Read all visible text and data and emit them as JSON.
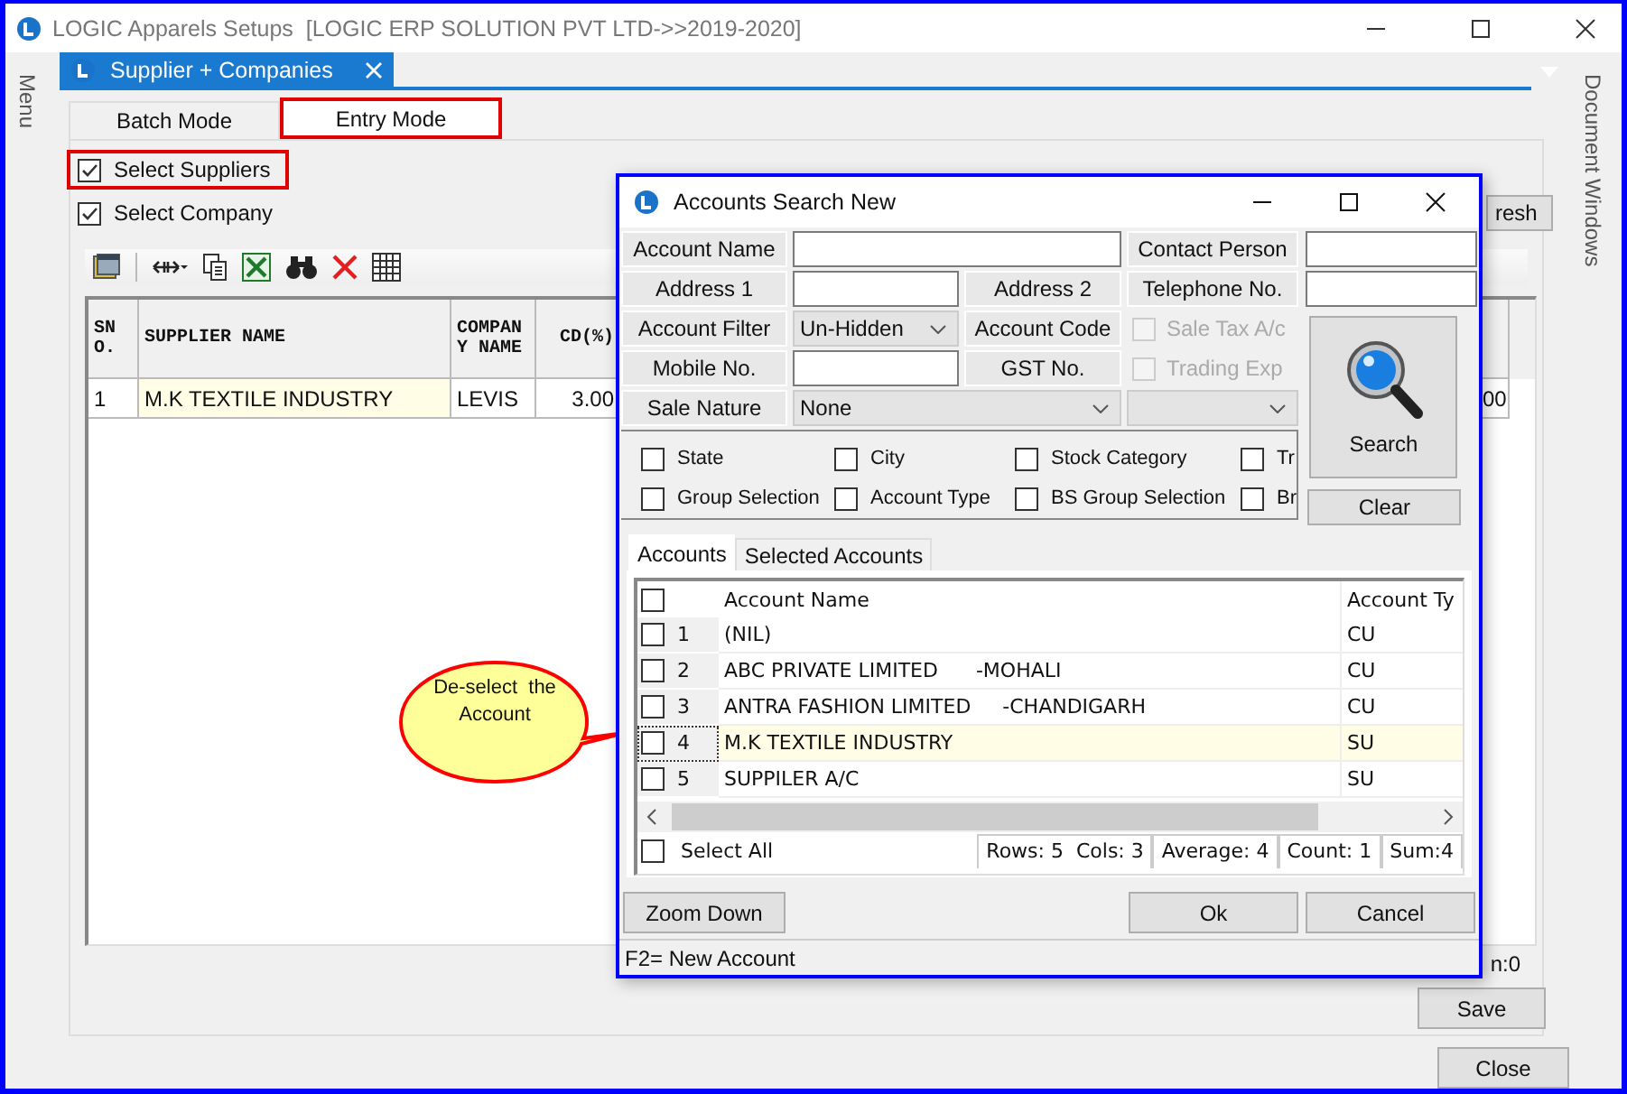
{
  "window": {
    "title": "LOGIC Apparels Setups  [LOGIC ERP SOLUTION PVT LTD->>2019-2020]"
  },
  "side_left": {
    "label": "Menu"
  },
  "side_right": {
    "label": "Document Windows"
  },
  "doc_tabs": [
    {
      "label": "Supplier + Companies",
      "selected": true
    }
  ],
  "mode_tabs": [
    {
      "label": "Batch Mode",
      "selected": false,
      "highlighted": false
    },
    {
      "label": "Entry Mode",
      "selected": true,
      "highlighted": true
    }
  ],
  "options": [
    {
      "label": "Select Suppliers",
      "checked": true,
      "highlighted": true
    },
    {
      "label": "Select Company",
      "checked": true,
      "highlighted": false
    }
  ],
  "refresh_button": {
    "label": "resh"
  },
  "grid": {
    "columns": [
      "SNO.",
      "SUPPLIER NAME",
      "COMPANY NAME",
      "CD(%)"
    ],
    "rows": [
      {
        "cells": [
          "1",
          "M.K TEXTILE INDUSTRY",
          "LEVIS",
          "3.00"
        ],
        "tail": "00",
        "selected": true
      }
    ],
    "summary_tail": "n:0"
  },
  "buttons": [
    "Save",
    "Close"
  ],
  "callout": {
    "text": "De-select  the Account"
  },
  "dialog": {
    "title": "Accounts Search New",
    "form": [
      [
        {
          "kind": "label",
          "text": "Account Name"
        },
        {
          "kind": "wide_input"
        },
        {
          "kind": "label",
          "text": "Contact Person"
        }
      ],
      [
        {
          "kind": "label",
          "text": "Address 1"
        },
        {
          "kind": "input"
        },
        {
          "kind": "label",
          "text": "Address 2"
        },
        {
          "kind": "label",
          "text": "Telephone No."
        }
      ],
      [
        {
          "kind": "label",
          "text": "Account Filter"
        },
        {
          "kind": "select",
          "value": "Un-Hidden"
        },
        {
          "kind": "label",
          "text": "Account Code"
        },
        {
          "kind": "check",
          "text": "Sale Tax A/c",
          "checked": false,
          "disabled": true
        }
      ],
      [
        {
          "kind": "label",
          "text": "Mobile No."
        },
        {
          "kind": "input"
        },
        {
          "kind": "label",
          "text": "GST No."
        },
        {
          "kind": "check",
          "text": "Trading Exp",
          "checked": false,
          "disabled": true
        }
      ],
      [
        {
          "kind": "label",
          "text": "Sale Nature"
        },
        {
          "kind": "wide_select",
          "value": "None"
        },
        {
          "kind": "select"
        }
      ]
    ],
    "side_inputs": [
      {
        "kind": "input"
      },
      {
        "kind": "input"
      }
    ],
    "search_button": "Search",
    "clear_button": "Clear",
    "filters": [
      {
        "label": "State",
        "checked": false
      },
      {
        "label": "City",
        "checked": false
      },
      {
        "label": "Stock Category",
        "checked": false
      },
      {
        "label": "Tr",
        "checked": false
      },
      {
        "label": "Group Selection",
        "checked": false
      },
      {
        "label": "Account Type",
        "checked": false
      },
      {
        "label": "BS Group Selection",
        "checked": false
      },
      {
        "label": "Br",
        "checked": false
      }
    ],
    "tabs": [
      {
        "label": "Accounts",
        "selected": true
      },
      {
        "label": "Selected Accounts",
        "selected": false
      }
    ],
    "accounts": {
      "header_checked": false,
      "columns": [
        "Account Name",
        "Account Ty"
      ],
      "rows": [
        {
          "no": "1",
          "name": "(NIL)",
          "type": "CU",
          "checked": false,
          "selected": false
        },
        {
          "no": "2",
          "name": "ABC PRIVATE LIMITED      -MOHALI",
          "type": "CU",
          "checked": false,
          "selected": false
        },
        {
          "no": "3",
          "name": "ANTRA FASHION LIMITED     -CHANDIGARH",
          "type": "CU",
          "checked": false,
          "selected": false
        },
        {
          "no": "4",
          "name": "M.K TEXTILE INDUSTRY",
          "type": "SU",
          "checked": false,
          "selected": true
        },
        {
          "no": "5",
          "name": "SUPPILER A/C",
          "type": "SU",
          "checked": false,
          "selected": false
        }
      ],
      "select_all": {
        "label": "Select All",
        "checked": false
      },
      "stats": [
        "Rows: 5  Cols: 3",
        "Average: 4",
        "Count: 1",
        "Sum:4"
      ]
    },
    "buttons": [
      "Zoom Down",
      "Ok",
      "Cancel"
    ],
    "status": "F2= New Account"
  }
}
